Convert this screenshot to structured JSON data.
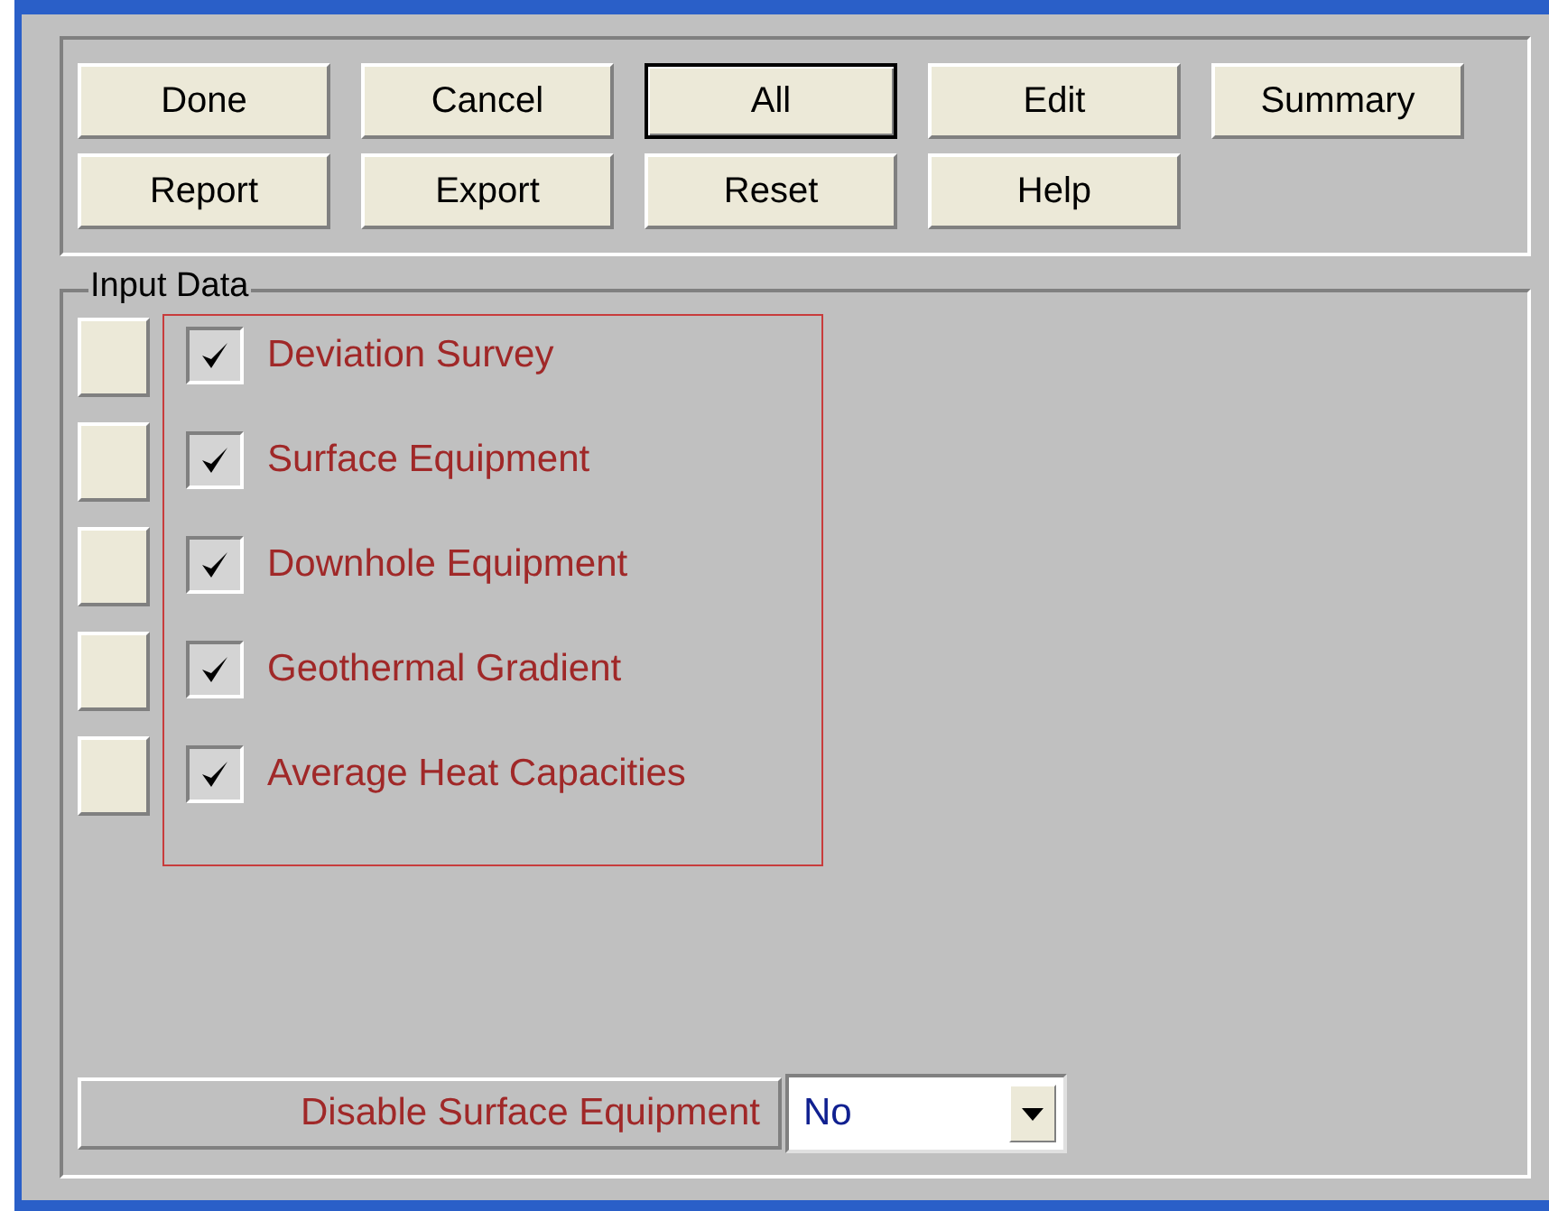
{
  "buttons": [
    {
      "label": "Done",
      "focused": false
    },
    {
      "label": "Cancel",
      "focused": false
    },
    {
      "label": "All",
      "focused": true
    },
    {
      "label": "Edit",
      "focused": false
    },
    {
      "label": "Summary",
      "focused": false
    },
    {
      "label": "Report",
      "focused": false
    },
    {
      "label": "Export",
      "focused": false
    },
    {
      "label": "Reset",
      "focused": false
    },
    {
      "label": "Help",
      "focused": false
    }
  ],
  "input_data": {
    "title": "Input Data",
    "items": [
      {
        "label": "Deviation Survey",
        "checked": true
      },
      {
        "label": "Surface Equipment",
        "checked": true
      },
      {
        "label": "Downhole Equipment",
        "checked": true
      },
      {
        "label": "Geothermal Gradient",
        "checked": true
      },
      {
        "label": "Average Heat Capacities",
        "checked": true
      }
    ]
  },
  "disable_surface_equipment": {
    "label": "Disable Surface Equipment",
    "value": "No"
  }
}
